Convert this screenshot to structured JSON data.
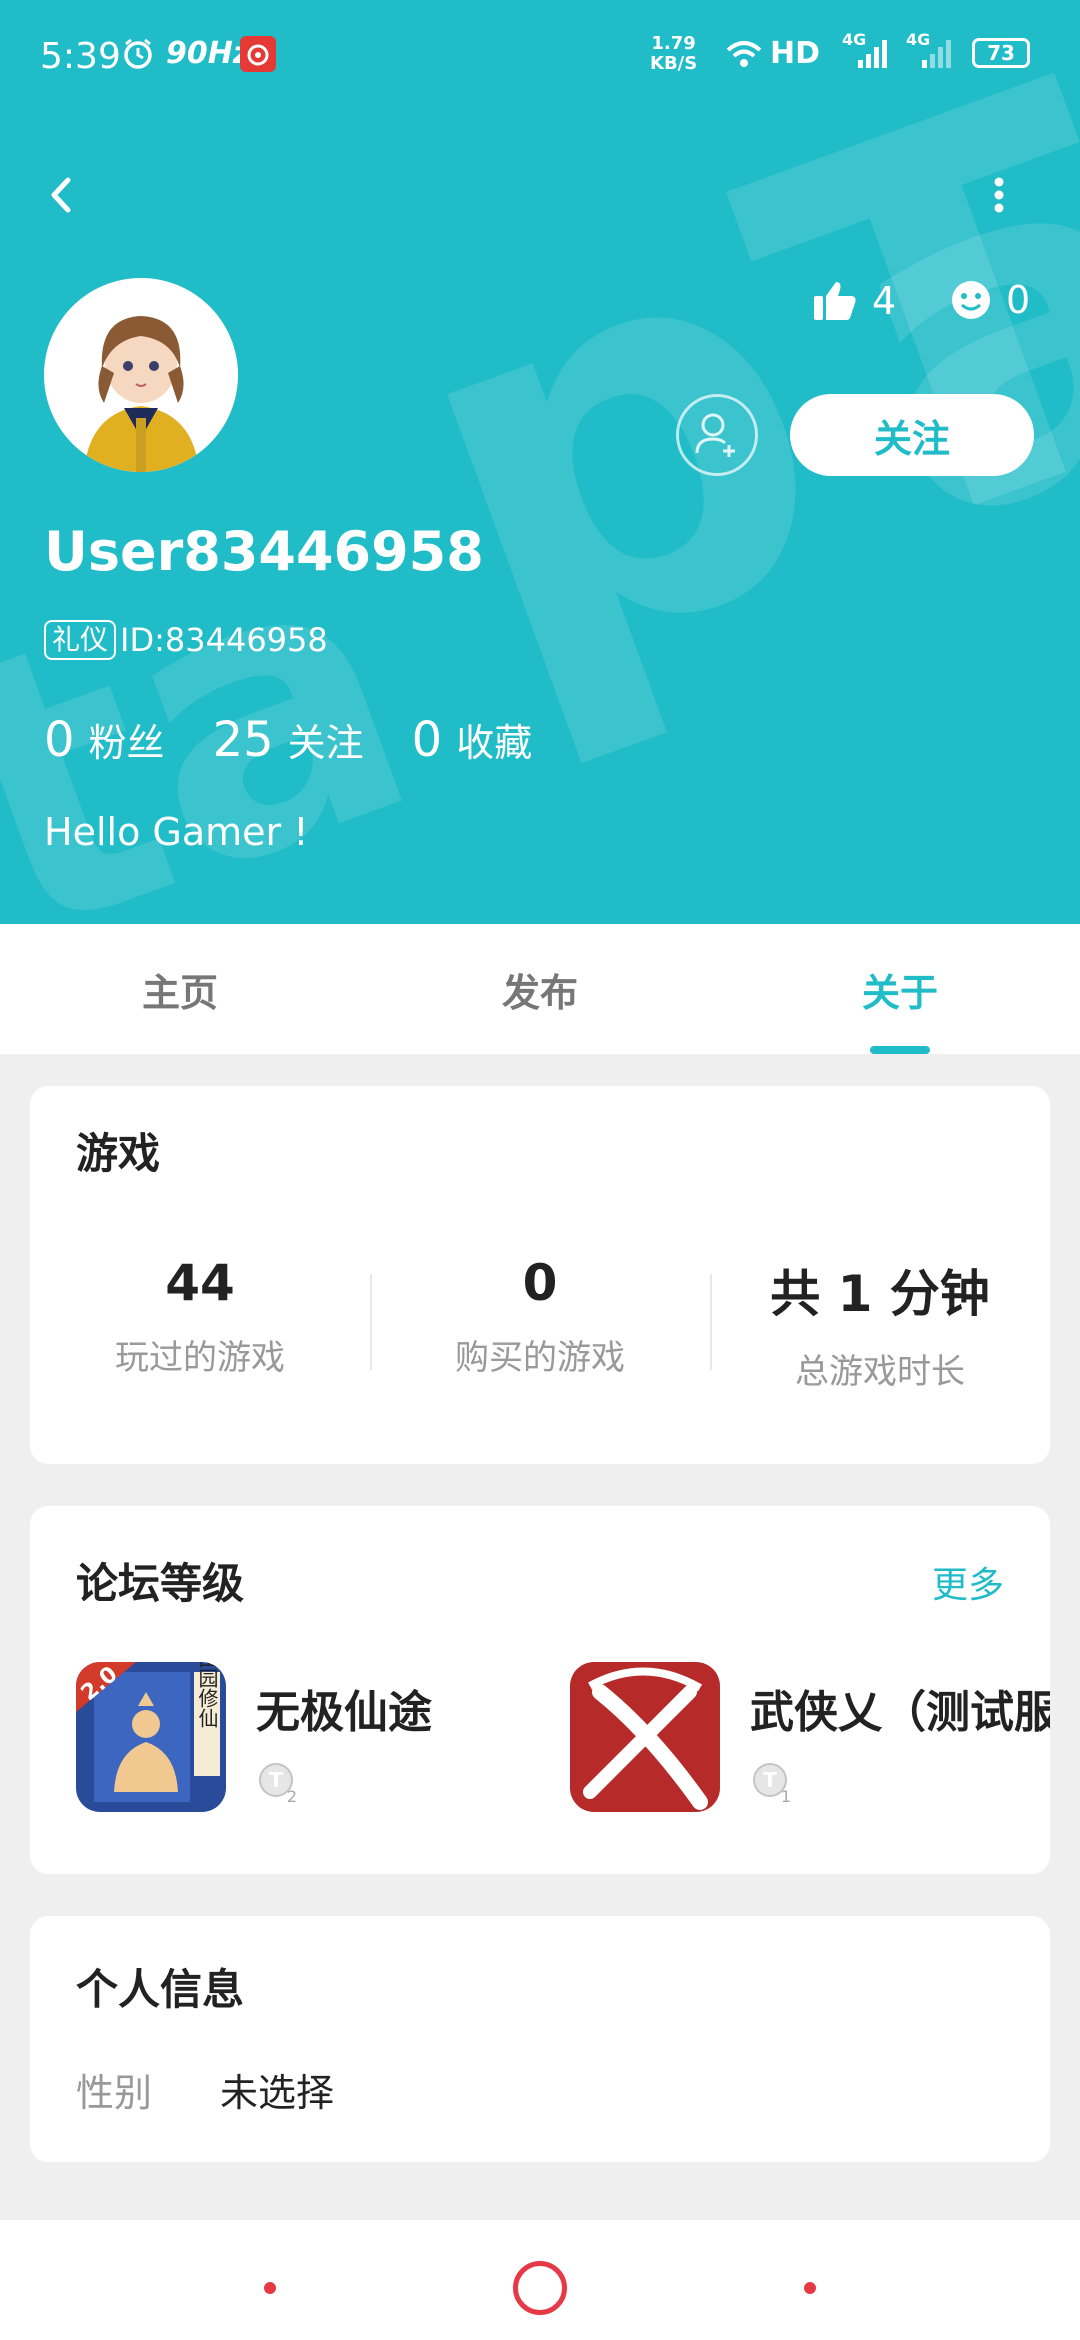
{
  "status_bar": {
    "time": "5:39",
    "refresh_rate": "90Hz",
    "net_speed_value": "1.79",
    "net_speed_unit": "KB/S",
    "hd_label": "HD",
    "net1": "4G",
    "net2": "4G",
    "battery": "73"
  },
  "profile": {
    "likes": "4",
    "smiles": "0",
    "follow_label": "关注",
    "username": "User83446958",
    "badge": "礼仪",
    "id_text": "ID:83446958",
    "counts": [
      {
        "num": "0",
        "label": "粉丝"
      },
      {
        "num": "25",
        "label": "关注"
      },
      {
        "num": "0",
        "label": "收藏"
      }
    ],
    "bio": "Hello Gamer !"
  },
  "tabs": [
    "主页",
    "发布",
    "关于"
  ],
  "active_tab": 2,
  "games": {
    "title": "游戏",
    "stats": [
      {
        "value": "44",
        "label": "玩过的游戏"
      },
      {
        "value": "0",
        "label": "购买的游戏"
      },
      {
        "value": "共 1 分钟",
        "label": "总游戏时长"
      }
    ]
  },
  "forum": {
    "title": "论坛等级",
    "more": "更多",
    "items": [
      {
        "name": "无极仙途",
        "level": "2",
        "icon_text": "田园修仙",
        "icon_version": "2.0"
      },
      {
        "name": "武侠乂（测试服",
        "level": "1"
      }
    ]
  },
  "personal": {
    "title": "个人信息",
    "gender_label": "性别",
    "gender_value": "未选择"
  },
  "colors": {
    "accent": "#20bcc8",
    "nav": "#e53945"
  }
}
